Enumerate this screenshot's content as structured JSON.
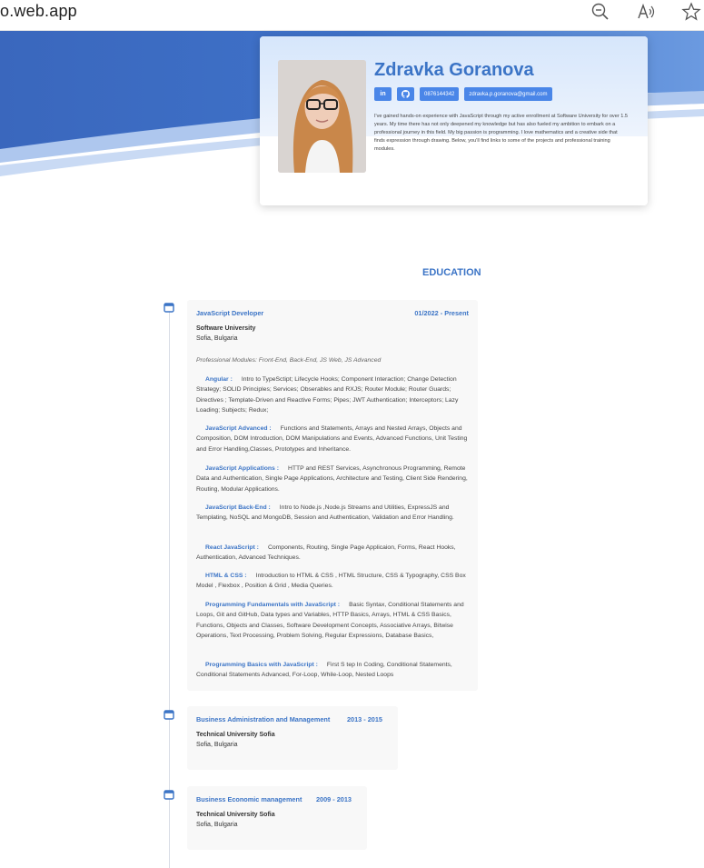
{
  "browser": {
    "url": "o.web.app",
    "icons": [
      "zoom-out-icon",
      "read-aloud-icon",
      "favorite-star-icon"
    ]
  },
  "colors": {
    "accent": "#3b74c6",
    "chip": "#4a86e8",
    "hero_blue": "#3f72c9"
  },
  "profile": {
    "name": "Zdravka Goranova",
    "links": [
      {
        "icon": "linkedin-icon",
        "label": "in"
      },
      {
        "icon": "github-icon",
        "label": ""
      },
      {
        "icon": "phone",
        "label": "0876144342"
      },
      {
        "icon": "email",
        "label": "zdravka.p.goranova@gmail.com"
      }
    ],
    "about": "I've gained hands-on experience with JavaScript through my active enrollment at Software University for over 1.5 years. My time there has not only deepened my knowledge but has also fueled my ambition to embark on a professional journey in this field. My big passion is programming. I love mathematics and a creative side that finds expression through drawing. Below, you'll find links to some of the projects and professional training modules."
  },
  "education": {
    "title": "EDUCATION",
    "entries": [
      {
        "position": "JavaScript Developer",
        "date": "01/2022 - Present",
        "org": "Software University",
        "location": "Sofia, Bulgaria",
        "modules_label": "Professional Modules: Front-End, Back-End, JS Web, JS Advanced",
        "modules": [
          {
            "title": "Angular :",
            "text": "Intro to TypeSctipt; Lifecycle Hooks; Component Interaction; Change Detection Strategy; SOLID Principles; Services; Obserables and RXJS; Router Module; Router Guards; Directives ; Template-Driven and Reactive Forms; Pipes; JWT Authentication; Interceptors; Lazy Loading; Subjects; Redux;"
          },
          {
            "title": "JavaScript Advanced :",
            "text": "Functions and Statements, Arrays and Nested Arrays, Objects and Composition, DOM Introduction, DOM Manipulations and Events, Advanced Functions, Unit Testing and Error Handling,Classes, Prototypes and Inheritance."
          },
          {
            "title": "JavaScript Applications :",
            "text": "HTTP and REST Services, Asynchronous Programming, Remote Data and Authentication, Single Page Applications, Architecture and Testing, Client Side Rendering, Routing, Modular Applications."
          },
          {
            "title": "JavaScript Back-End :",
            "text": "Intro to Node.js ,Node.js Streams and Utilities, ExpressJS and Templating, NoSQL and MongoDB, Session and Authentication, Validation and Error Handling."
          },
          {
            "title": "React JavaScript :",
            "text": "Components, Routing, Single Page Applicaion, Forms, React Hooks, Authentication, Advanced Techniques."
          },
          {
            "title": "HTML & CSS :",
            "text": "Introduction to HTML & CSS , HTML Structure, CSS & Typography, CSS Box Model , Flexbox , Position & Grid , Media Queries."
          },
          {
            "title": "Programming Fundamentals with JavaScript :",
            "text": "Basic Syntax, Conditional Statements and Loops, Git and GitHub, Data types and Variables, HTTP Basics, Arrays, HTML & CSS Basics, Functions, Objects and Classes, Software Development Concepts, Associative Arrays, Bitwise Operations, Text Processing, Problem Solving, Regular Expressions, Database Basics,"
          },
          {
            "title": "Programming Basics with JavaScript :",
            "text": "First S tep In Coding, Conditional Statements, Conditional Statements Advanced, For-Loop, While-Loop, Nested Loops"
          }
        ]
      },
      {
        "position": "Business Administration and Management",
        "date": "2013 - 2015",
        "org": "Technical University Sofia",
        "location": "Sofia, Bulgaria"
      },
      {
        "position": "Business Economic management",
        "date": "2009 - 2013",
        "org": "Technical University Sofia",
        "location": "Sofia, Bulgaria"
      }
    ]
  }
}
